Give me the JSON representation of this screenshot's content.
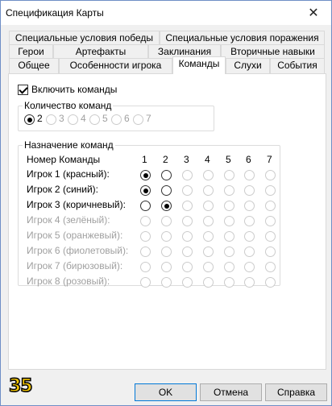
{
  "window": {
    "title": "Спецификация Карты",
    "close_glyph": "✕"
  },
  "tabs_row1": [
    "Специальные условия победы",
    "Специальные условия поражения"
  ],
  "tabs_row2": [
    "Герои",
    "Артефакты",
    "Заклинания",
    "Вторичные навыки"
  ],
  "tabs_row3": [
    "Общее",
    "Особенности игрока",
    "Команды",
    "Слухи",
    "События"
  ],
  "active_tab": "Команды",
  "enable_teams": {
    "label": "Включить команды",
    "checked": true
  },
  "team_count": {
    "legend": "Количество команд",
    "options": [
      "2",
      "3",
      "4",
      "5",
      "6",
      "7"
    ],
    "selected": "2"
  },
  "assignment": {
    "legend": "Назначение команд",
    "header_label": "Номер Команды",
    "columns": [
      "1",
      "2",
      "3",
      "4",
      "5",
      "6",
      "7"
    ],
    "players": [
      {
        "name": "Игрок 1 (красный):",
        "enabled": true,
        "team": 1
      },
      {
        "name": "Игрок 2 (синий):",
        "enabled": true,
        "team": 1
      },
      {
        "name": "Игрок 3 (коричневый):",
        "enabled": true,
        "team": 2
      },
      {
        "name": "Игрок 4 (зелёный):",
        "enabled": false,
        "team": null
      },
      {
        "name": "Игрок 5 (оранжевый):",
        "enabled": false,
        "team": null
      },
      {
        "name": "Игрок 6 (фиолетовый):",
        "enabled": false,
        "team": null
      },
      {
        "name": "Игрок 7 (бирюзовый):",
        "enabled": false,
        "team": null
      },
      {
        "name": "Игрок 8 (розовый):",
        "enabled": false,
        "team": null
      }
    ]
  },
  "buttons": {
    "ok": "OK",
    "cancel": "Отмена",
    "help": "Справка"
  },
  "badge": "35"
}
